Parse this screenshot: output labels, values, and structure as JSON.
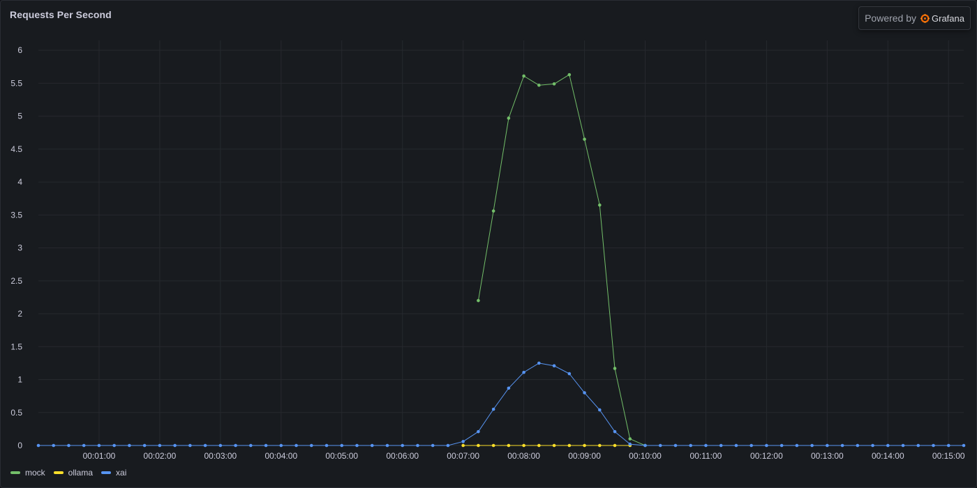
{
  "panel": {
    "title": "Requests Per Second"
  },
  "powered_by": {
    "label": "Powered by",
    "brand": "Grafana",
    "icon": "grafana-logo-icon"
  },
  "colors": {
    "mock": "#73bf69",
    "ollama": "#fade2a",
    "xai": "#5794f2",
    "grid": "#26292e",
    "axis_text": "#ccccdc"
  },
  "chart_data": {
    "type": "line",
    "title": "Requests Per Second",
    "xlabel": "",
    "ylabel": "",
    "ylim": [
      0,
      6.15
    ],
    "y_ticks": [
      0,
      0.5,
      1,
      1.5,
      2,
      2.5,
      3,
      3.5,
      4,
      4.5,
      5,
      5.5,
      6
    ],
    "y_tick_labels": [
      "0",
      "0.5",
      "1",
      "1.5",
      "2",
      "2.5",
      "3",
      "3.5",
      "4",
      "4.5",
      "5",
      "5.5",
      "6"
    ],
    "x_range_seconds": [
      0,
      915
    ],
    "x_ticks_seconds": [
      60,
      120,
      180,
      240,
      300,
      360,
      420,
      480,
      540,
      600,
      660,
      720,
      780,
      840,
      900
    ],
    "x_tick_labels": [
      "00:01:00",
      "00:02:00",
      "00:03:00",
      "00:04:00",
      "00:05:00",
      "00:06:00",
      "00:07:00",
      "00:08:00",
      "00:09:00",
      "00:10:00",
      "00:11:00",
      "00:12:00",
      "00:13:00",
      "00:14:00",
      "00:15:00"
    ],
    "grid": true,
    "legend_position": "bottom-left",
    "series": [
      {
        "name": "mock",
        "color": "#73bf69",
        "x": [
          435,
          450,
          465,
          480,
          495,
          510,
          525,
          540,
          555,
          570,
          585,
          600
        ],
        "values": [
          2.2,
          3.56,
          4.97,
          5.61,
          5.47,
          5.49,
          5.63,
          4.65,
          3.65,
          1.17,
          0.1,
          0
        ]
      },
      {
        "name": "ollama",
        "color": "#fade2a",
        "x": [
          420,
          435,
          450,
          465,
          480,
          495,
          510,
          525,
          540,
          555,
          570,
          585
        ],
        "values": [
          0,
          0,
          0,
          0,
          0,
          0,
          0,
          0,
          0,
          0,
          0,
          0
        ]
      },
      {
        "name": "xai",
        "color": "#5794f2",
        "x": [
          0,
          15,
          30,
          45,
          60,
          75,
          90,
          105,
          120,
          135,
          150,
          165,
          180,
          195,
          210,
          225,
          240,
          255,
          270,
          285,
          300,
          315,
          330,
          345,
          360,
          375,
          390,
          405,
          420,
          435,
          450,
          465,
          480,
          495,
          510,
          525,
          540,
          555,
          570,
          585,
          600,
          615,
          630,
          645,
          660,
          675,
          690,
          705,
          720,
          735,
          750,
          765,
          780,
          795,
          810,
          825,
          840,
          855,
          870,
          885,
          900,
          915
        ],
        "values": [
          0,
          0,
          0,
          0,
          0,
          0,
          0,
          0,
          0,
          0,
          0,
          0,
          0,
          0,
          0,
          0,
          0,
          0,
          0,
          0,
          0,
          0,
          0,
          0,
          0,
          0,
          0,
          0,
          0.06,
          0.21,
          0.55,
          0.87,
          1.11,
          1.25,
          1.21,
          1.09,
          0.8,
          0.54,
          0.21,
          0.02,
          0,
          0,
          0,
          0,
          0,
          0,
          0,
          0,
          0,
          0,
          0,
          0,
          0,
          0,
          0,
          0,
          0,
          0,
          0,
          0,
          0,
          0
        ]
      }
    ]
  }
}
